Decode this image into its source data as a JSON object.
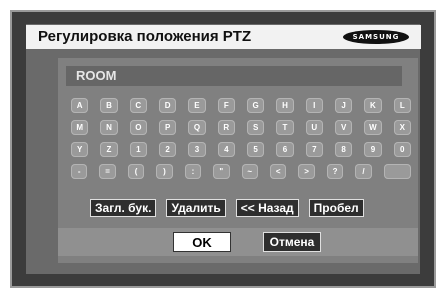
{
  "dialog": {
    "title": "Регулировка положения PTZ",
    "logo_text": "SAMSUNG"
  },
  "input": {
    "value": "ROOM"
  },
  "keyboard": {
    "rows": [
      [
        "A",
        "B",
        "C",
        "D",
        "E",
        "F",
        "G",
        "H",
        "I",
        "J",
        "K",
        "L"
      ],
      [
        "M",
        "N",
        "O",
        "P",
        "Q",
        "R",
        "S",
        "T",
        "U",
        "V",
        "W",
        "X"
      ],
      [
        "Y",
        "Z",
        "1",
        "2",
        "3",
        "4",
        "5",
        "6",
        "7",
        "8",
        "9",
        "0"
      ],
      [
        "-",
        "=",
        "(",
        ")",
        ":",
        "\"",
        "~",
        "<",
        ">",
        "?",
        "/",
        ""
      ]
    ]
  },
  "actions": {
    "caps_label": "Загл. бук.",
    "delete_label": "Удалить",
    "back_label": "<< Назад",
    "space_label": "Пробел",
    "ok_label": "OK",
    "cancel_label": "Отмена"
  }
}
